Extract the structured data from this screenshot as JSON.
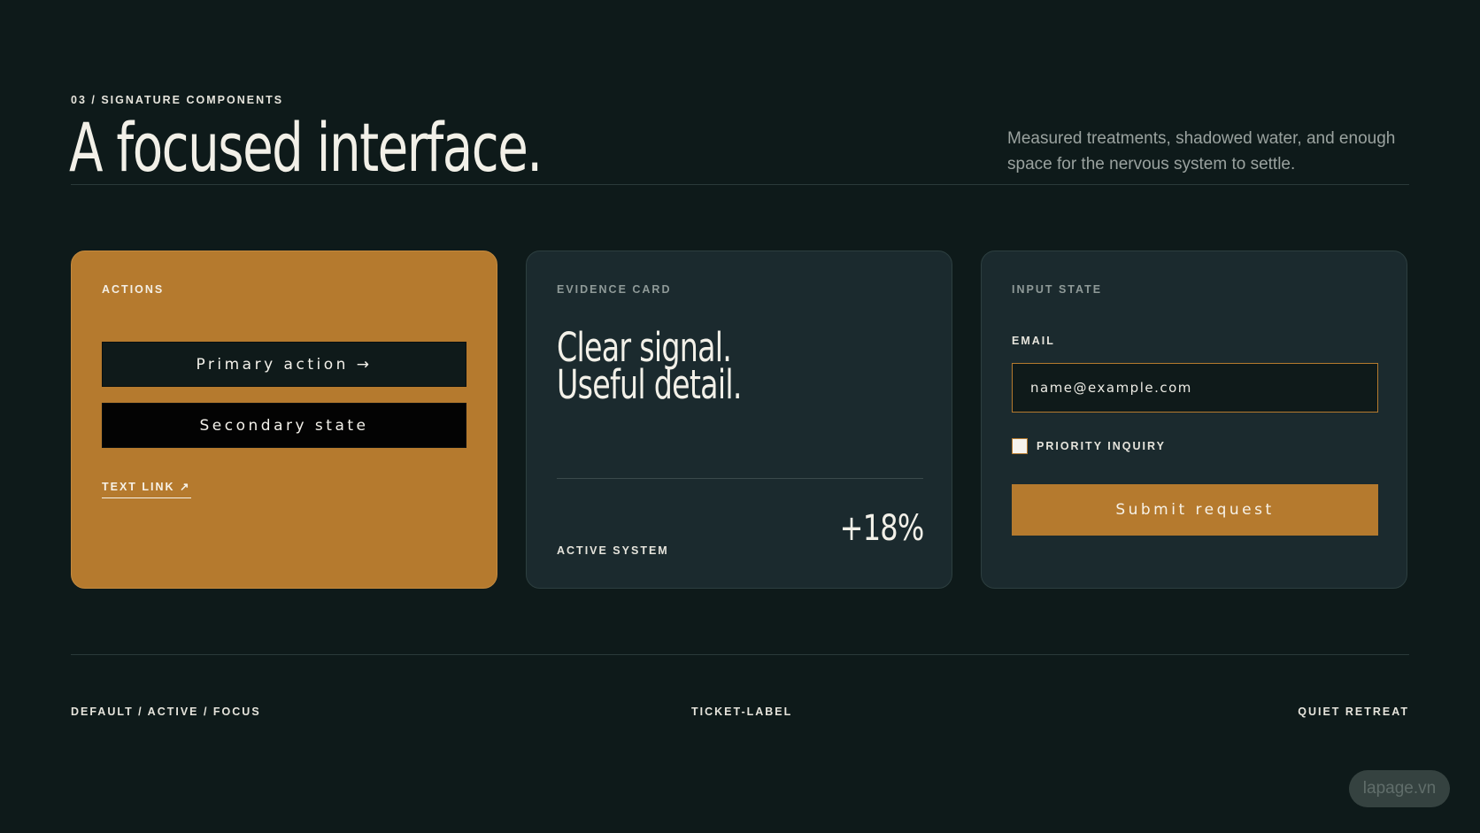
{
  "header": {
    "eyebrow": "03 / SIGNATURE COMPONENTS",
    "title": "A focused interface.",
    "subtitle": "Measured treatments, shadowed water, and enough space for the nervous system to settle."
  },
  "actions_card": {
    "label": "ACTIONS",
    "primary_button": "Primary action →",
    "secondary_button": "Secondary state",
    "text_link": "TEXT LINK ↗"
  },
  "evidence_card": {
    "label": "EVIDENCE CARD",
    "headline_line1": "Clear signal.",
    "headline_line2": "Useful detail.",
    "footer_label": "ACTIVE SYSTEM",
    "stat": "+18%"
  },
  "input_card": {
    "label": "INPUT STATE",
    "field_label": "EMAIL",
    "email_value": "name@example.com",
    "checkbox_label": "PRIORITY INQUIRY",
    "checkbox_checked": false,
    "submit_button": "Submit request"
  },
  "footer": {
    "left": "DEFAULT / ACTIVE / FOCUS",
    "center": "TICKET-LABEL",
    "right": "QUIET RETREAT"
  },
  "watermark": "lapage.vn",
  "colors": {
    "background": "#0e1a1a",
    "accent": "#b57a2e",
    "card": "#1b2a2e"
  }
}
